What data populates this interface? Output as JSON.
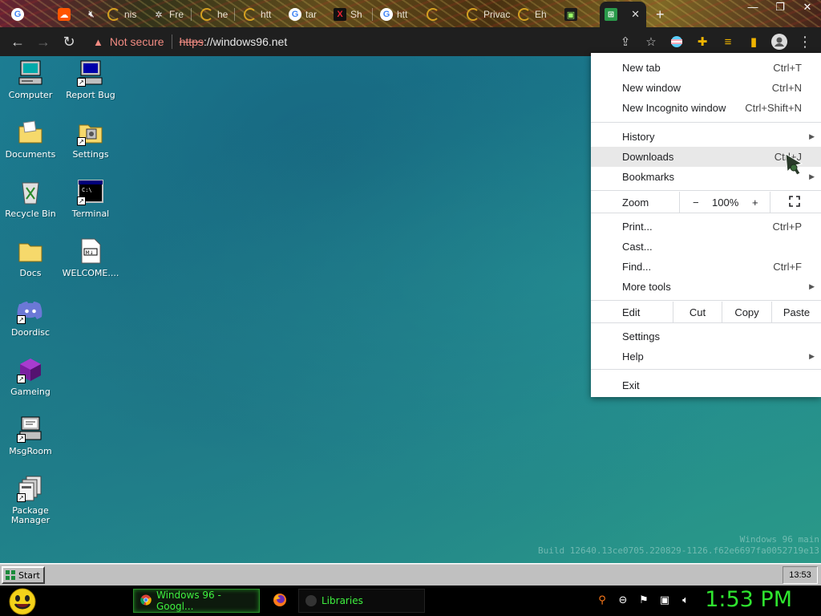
{
  "browser": {
    "tabs": [
      {
        "title": "",
        "favicon": "google-icon"
      },
      {
        "title": "",
        "favicon": "soundcloud-icon"
      },
      {
        "title": "",
        "favicon": "mute-icon"
      },
      {
        "title": "nis",
        "favicon": "loading-icon"
      },
      {
        "title": "Fre",
        "favicon": "bug-icon"
      },
      {
        "title": "he",
        "favicon": "loading-icon"
      },
      {
        "title": "htt",
        "favicon": "loading-icon"
      },
      {
        "title": "tar",
        "favicon": "google-icon"
      },
      {
        "title": "Sh",
        "favicon": "x-icon"
      },
      {
        "title": "htt",
        "favicon": "google-icon"
      },
      {
        "title": "",
        "favicon": "loading-icon"
      },
      {
        "title": "Privac",
        "favicon": "loading-icon"
      },
      {
        "title": "Eh",
        "favicon": "loading-icon"
      },
      {
        "title": "",
        "favicon": "app-icon"
      },
      {
        "title": "",
        "favicon": "windows96-icon",
        "active": true
      }
    ],
    "security_label": "Not secure",
    "url_scheme": "https",
    "url_rest": "://windows96.net"
  },
  "menu": {
    "new_tab": "New tab",
    "new_tab_sc": "Ctrl+T",
    "new_window": "New window",
    "new_window_sc": "Ctrl+N",
    "new_incognito": "New Incognito window",
    "new_incognito_sc": "Ctrl+Shift+N",
    "history": "History",
    "downloads": "Downloads",
    "downloads_sc": "Ctrl+J",
    "bookmarks": "Bookmarks",
    "zoom": "Zoom",
    "zoom_minus": "−",
    "zoom_value": "100%",
    "zoom_plus": "+",
    "print": "Print...",
    "print_sc": "Ctrl+P",
    "cast": "Cast...",
    "find": "Find...",
    "find_sc": "Ctrl+F",
    "more_tools": "More tools",
    "edit": "Edit",
    "cut": "Cut",
    "copy": "Copy",
    "paste": "Paste",
    "settings": "Settings",
    "help": "Help",
    "exit": "Exit"
  },
  "desktop": {
    "icons": [
      {
        "label": "Computer",
        "icon": "computer-icon"
      },
      {
        "label": "Report Bug",
        "icon": "report-bug-icon"
      },
      {
        "label": "Documents",
        "icon": "documents-folder-icon"
      },
      {
        "label": "Settings",
        "icon": "settings-folder-icon"
      },
      {
        "label": "Recycle Bin",
        "icon": "recycle-bin-icon"
      },
      {
        "label": "Terminal",
        "icon": "terminal-icon"
      },
      {
        "label": "Docs",
        "icon": "folder-icon"
      },
      {
        "label": "WELCOME....",
        "icon": "markdown-file-icon"
      },
      {
        "label": "Doordisc",
        "icon": "discord-icon"
      },
      {
        "label": "Gameing",
        "icon": "cube-icon"
      },
      {
        "label": "MsgRoom",
        "icon": "msgroom-icon"
      },
      {
        "label": "Package\nManager",
        "icon": "package-icon"
      }
    ],
    "build_line1": "Windows 96 main",
    "build_line2": "Build 12640.13ce0705.220829-1126.f62e6697fa0052719e13"
  },
  "w96_taskbar": {
    "start_label": "Start",
    "clock": "13:53"
  },
  "host_taskbar": {
    "task_chrome": "Windows 96 - Googl...",
    "task_libraries": "Libraries",
    "clock": "1:53 PM"
  },
  "colors": {
    "accent_green": "#2fe52f",
    "warning_red": "#f28b82",
    "desktop_teal": "#1d7f94"
  }
}
